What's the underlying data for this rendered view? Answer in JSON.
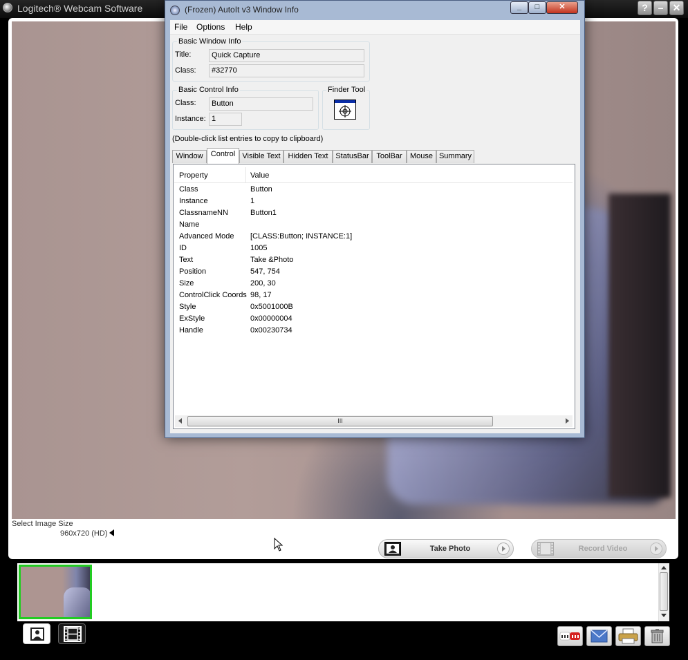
{
  "logitech": {
    "title": "Logitech® Webcam Software",
    "help_btn": "?",
    "min_btn": "–",
    "close_btn": "✕",
    "image_size_label": "Select Image Size",
    "image_size_value": "960x720 (HD)",
    "take_photo_label": "Take Photo",
    "record_video_label": "Record Video",
    "share_buttons": [
      "youtube-icon",
      "email-icon",
      "print-icon",
      "trash-icon"
    ],
    "selected_thumb_color": "#22cc22"
  },
  "autoit": {
    "title": "(Frozen) AutoIt v3 Window Info",
    "menu": [
      "File",
      "Options",
      "Help"
    ],
    "basic_window_info": {
      "group_title": "Basic Window Info",
      "title_label": "Title:",
      "title_value": "Quick Capture",
      "class_label": "Class:",
      "class_value": "#32770"
    },
    "basic_control_info": {
      "group_title": "Basic Control Info",
      "class_label": "Class:",
      "class_value": "Button",
      "instance_label": "Instance:",
      "instance_value": "1"
    },
    "finder_tool_label": "Finder Tool",
    "hint": "(Double-click list entries to copy to clipboard)",
    "tabs": [
      "Window",
      "Control",
      "Visible Text",
      "Hidden Text",
      "StatusBar",
      "ToolBar",
      "Mouse",
      "Summary"
    ],
    "active_tab": "Control",
    "columns": [
      "Property",
      "Value"
    ],
    "rows": [
      {
        "property": "Class",
        "value": "Button"
      },
      {
        "property": "Instance",
        "value": "1"
      },
      {
        "property": "ClassnameNN",
        "value": "Button1"
      },
      {
        "property": "Name",
        "value": ""
      },
      {
        "property": "Advanced Mode",
        "value": "[CLASS:Button; INSTANCE:1]"
      },
      {
        "property": "ID",
        "value": "1005"
      },
      {
        "property": "Text",
        "value": "Take &Photo"
      },
      {
        "property": "Position",
        "value": "547, 754"
      },
      {
        "property": "Size",
        "value": "200, 30"
      },
      {
        "property": "ControlClick Coords",
        "value": "98, 17"
      },
      {
        "property": "Style",
        "value": "0x5001000B"
      },
      {
        "property": "ExStyle",
        "value": "0x00000004"
      },
      {
        "property": "Handle",
        "value": "0x00230734"
      }
    ],
    "scroll_grip": "III"
  }
}
